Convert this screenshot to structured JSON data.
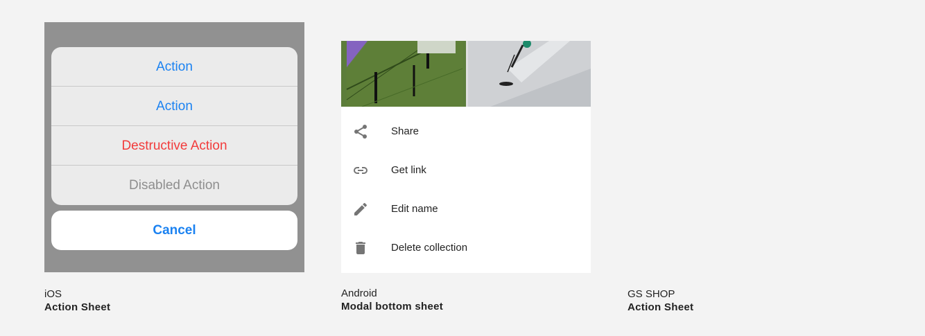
{
  "ios": {
    "actions": [
      {
        "label": "Action",
        "style": "default"
      },
      {
        "label": "Action",
        "style": "default"
      },
      {
        "label": "Destructive Action",
        "style": "destructive"
      },
      {
        "label": "Disabled Action",
        "style": "disabled"
      }
    ],
    "cancel_label": "Cancel",
    "caption_platform": "iOS",
    "caption_component": "Action Sheet"
  },
  "android": {
    "items": [
      {
        "label": "Share",
        "icon": "share-icon"
      },
      {
        "label": "Get link",
        "icon": "link-icon"
      },
      {
        "label": "Edit name",
        "icon": "pencil-icon"
      },
      {
        "label": "Delete collection",
        "icon": "trash-icon"
      }
    ],
    "caption_platform": "Android",
    "caption_component": "Modal bottom sheet"
  },
  "gsshop": {
    "caption_platform": "GS SHOP",
    "caption_component": "Action Sheet"
  },
  "colors": {
    "background": "#f3f3f3",
    "ios_overlay": "#919191",
    "ios_sheet": "#ebebeb",
    "ios_blue": "#1b82f1",
    "ios_red": "#f23b3b",
    "ios_disabled": "#8e8e8e",
    "android_icon": "#757575"
  }
}
